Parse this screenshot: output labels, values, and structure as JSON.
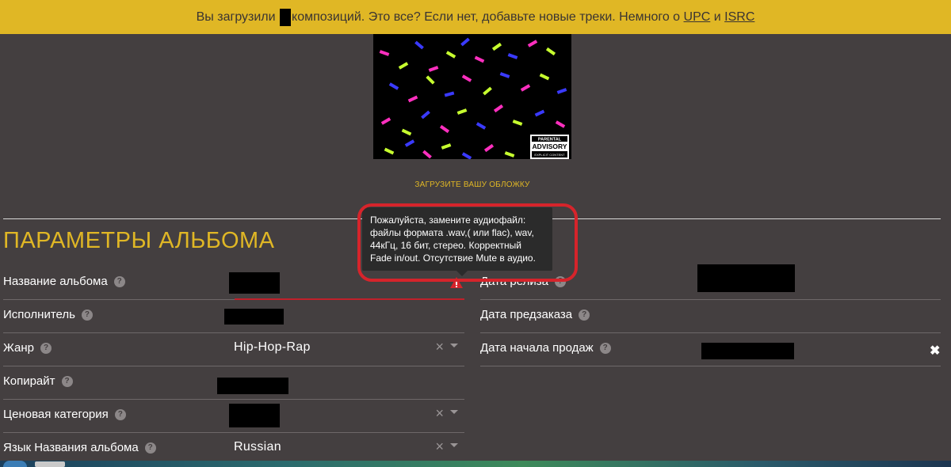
{
  "banner": {
    "text_before": "Вы загрузили",
    "text_after": "композиций. Это все? Если нет, добавьте новые треки. Немного о",
    "link_upc": "UPC",
    "conj": "и",
    "link_isrc": "ISRC"
  },
  "cover": {
    "advisory_line1": "PARENTAL",
    "advisory_line2": "ADVISORY",
    "advisory_line3": "EXPLICIT CONTENT"
  },
  "upload_cover_label": "ЗАГРУЗИТЕ ВАШУ ОБЛОЖКУ",
  "section_title": "ПАРАМЕТРЫ АЛЬБОМА",
  "left_fields": [
    {
      "label": "Название альбома"
    },
    {
      "label": "Исполнитель"
    },
    {
      "label": "Жанр",
      "value": "Hip-Hop-Rap"
    },
    {
      "label": "Копирайт"
    },
    {
      "label": "Ценовая категория"
    },
    {
      "label": "Язык Названия альбома",
      "value": "Russian"
    }
  ],
  "right_fields": [
    {
      "label": "Дата релиза"
    },
    {
      "label": "Дата предзаказа"
    },
    {
      "label": "Дата начала продаж"
    }
  ],
  "tooltip": {
    "text": "Пожалуйста, замените аудиофайл: файлы формата .wav,( или flac), wav, 44кГц, 16 бит, стерео. Корректный Fade in/out. Отсутствие Mute в аудио."
  },
  "icons": {
    "help": "?",
    "clear": "×",
    "close": "✖",
    "warning": "warning-icon"
  },
  "colors": {
    "background": "#443f40",
    "accent": "#e0b725",
    "highlight": "#d6242b"
  }
}
